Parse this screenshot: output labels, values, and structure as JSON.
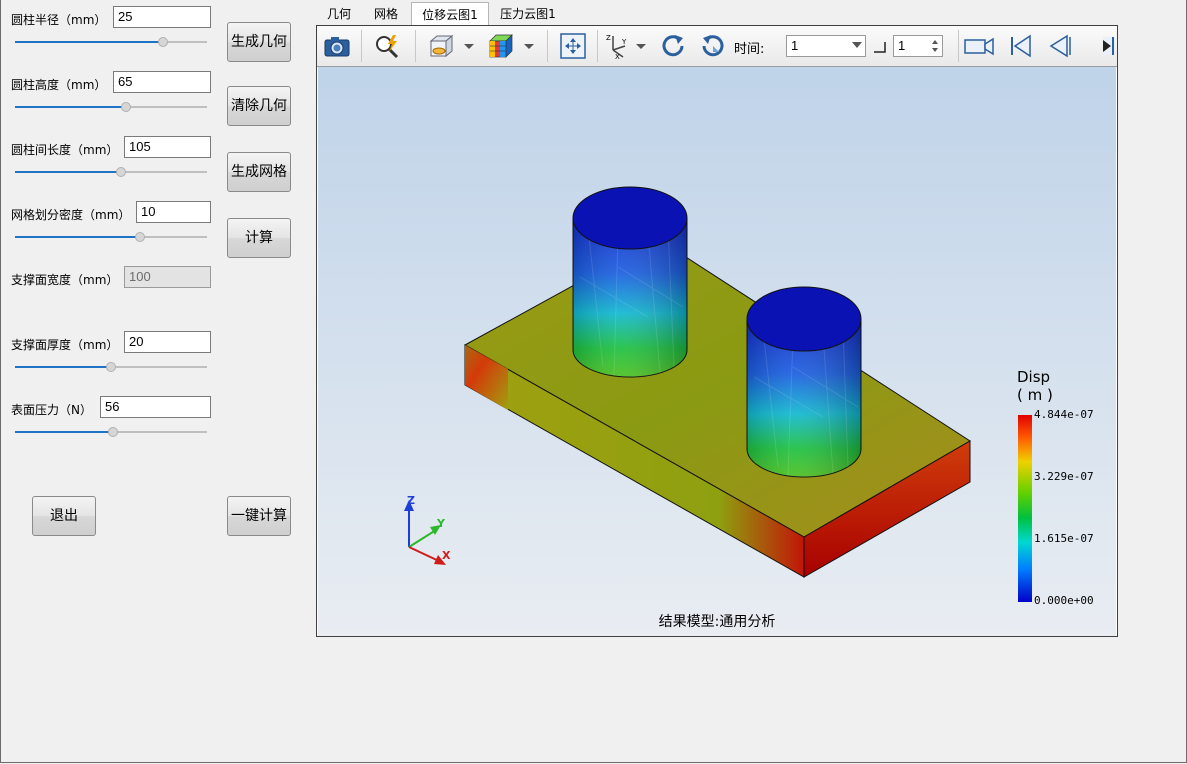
{
  "params": {
    "radius": {
      "label": "圆柱半径（mm）",
      "value": "25",
      "slider_fraction": 0.77
    },
    "height": {
      "label": "圆柱高度（mm）",
      "value": "65",
      "slider_fraction": 0.58
    },
    "spacing": {
      "label": "圆柱间长度（mm）",
      "value": "105",
      "slider_fraction": 0.55
    },
    "mesh_density": {
      "label": "网格划分密度（mm）",
      "value": "10",
      "slider_fraction": 0.65
    },
    "support_width": {
      "label": "支撑面宽度（mm）",
      "value": "100"
    },
    "support_thickness": {
      "label": "支撑面厚度（mm）",
      "value": "20",
      "slider_fraction": 0.5
    },
    "surface_pressure": {
      "label": "表面压力（N）",
      "value": "56",
      "slider_fraction": 0.51
    }
  },
  "buttons": {
    "generate_geometry": "生成几何",
    "clear_geometry": "清除几何",
    "generate_mesh": "生成网格",
    "compute": "计算",
    "exit": "退出",
    "one_click": "一键计算"
  },
  "tabs": [
    "几何",
    "网格",
    "位移云图1",
    "压力云图1"
  ],
  "active_tab": "位移云图1",
  "toolbar": {
    "time_label": "时间:",
    "time_value": "1",
    "step_value": "1",
    "icons": [
      "camera-icon",
      "zoom-icon",
      "view-box-icon",
      "color-cube-icon",
      "fit-view-icon",
      "axes-icon",
      "rotate-cw-icon",
      "rotate-ccw-icon",
      "record-video-icon",
      "first-frame-icon",
      "previous-frame-icon",
      "next-frame-icon"
    ]
  },
  "viewport": {
    "caption": "结果模型:通用分析",
    "axes": {
      "x": "X",
      "y": "Y",
      "z": "Z"
    },
    "legend": {
      "title": "Disp",
      "unit": "( m )",
      "ticks": [
        "4.844e-07",
        "3.229e-07",
        "1.615e-07",
        "0.000e+00"
      ]
    }
  },
  "colors": {
    "slider": "#1f74c6",
    "scale_top": "#e00000",
    "scale_bottom": "#0000c8"
  }
}
